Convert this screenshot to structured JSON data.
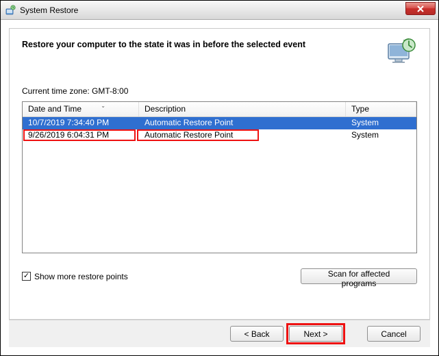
{
  "window": {
    "title": "System Restore"
  },
  "header": {
    "heading": "Restore your computer to the state it was in before the selected event"
  },
  "timezone_label": "Current time zone: GMT-8:00",
  "table": {
    "columns": {
      "datetime": "Date and Time",
      "description": "Description",
      "type": "Type"
    },
    "rows": [
      {
        "datetime": "10/7/2019 7:34:40 PM",
        "description": "Automatic Restore Point",
        "type": "System",
        "selected": true
      },
      {
        "datetime": "9/26/2019 6:04:31 PM",
        "description": "Automatic Restore Point",
        "type": "System",
        "highlighted": true
      }
    ]
  },
  "checkbox": {
    "label": "Show more restore points",
    "checked": true
  },
  "buttons": {
    "scan": "Scan for affected programs",
    "back": "< Back",
    "next": "Next >",
    "cancel": "Cancel"
  }
}
